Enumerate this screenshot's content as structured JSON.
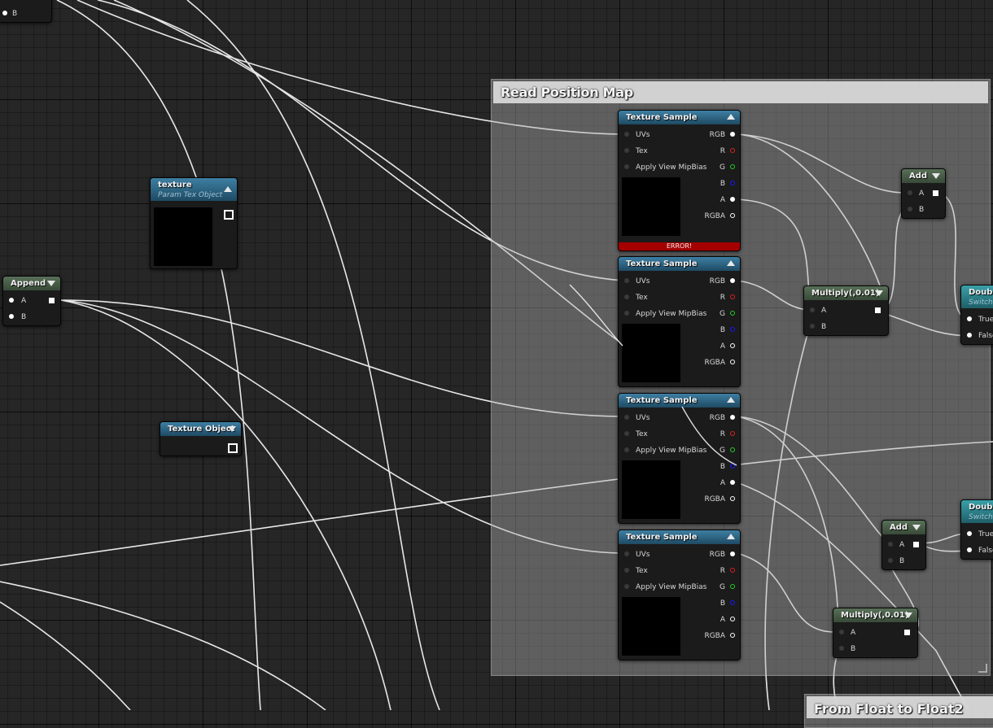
{
  "comments": {
    "read_position_map": "Read Position Map",
    "from_float": "From Float to Float2"
  },
  "nodes": {
    "top_left": {
      "pin_b": "B"
    },
    "append": {
      "title": "Append",
      "pin_a": "A",
      "pin_b": "B"
    },
    "texture_param": {
      "title": "texture",
      "subtitle": "Param Tex Object"
    },
    "texture_object": {
      "title": "Texture Object"
    },
    "texture_sample": {
      "title": "Texture Sample",
      "inputs": [
        "UVs",
        "Tex",
        "Apply View MipBias"
      ],
      "outputs": [
        "RGB",
        "R",
        "G",
        "B",
        "A",
        "RGBA"
      ],
      "error": "ERROR!"
    },
    "add": {
      "title": "Add",
      "pin_a": "A",
      "pin_b": "B"
    },
    "multiply": {
      "title": "Multiply(,0.01)",
      "pin_a": "A",
      "pin_b": "B"
    },
    "double_switch": {
      "title": "Double",
      "subtitle": "Switch",
      "pin_true": "True",
      "pin_false": "False"
    }
  },
  "colors": {
    "header_blue": "#2f6888",
    "header_green": "#4a5f4a",
    "error": "#a50000",
    "wire": "#ffffff"
  }
}
